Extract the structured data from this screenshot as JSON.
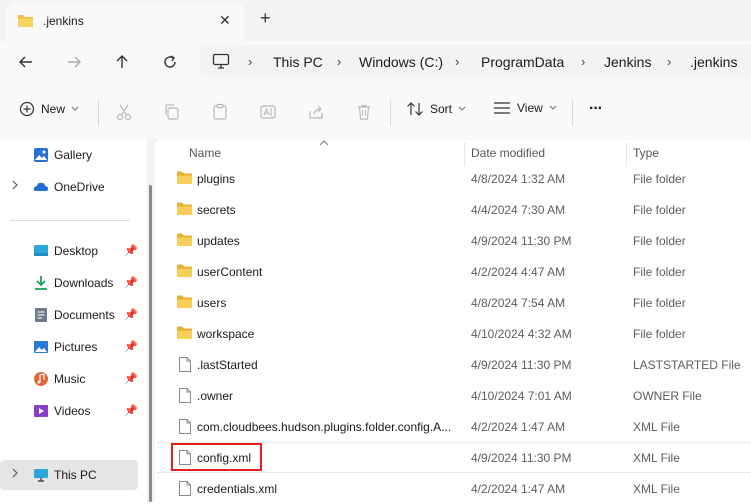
{
  "window": {
    "tab_title": ".jenkins",
    "close_glyph": "✕",
    "new_tab_glyph": "+"
  },
  "breadcrumb": {
    "items": [
      "This PC",
      "Windows (C:)",
      "ProgramData",
      "Jenkins",
      ".jenkins"
    ],
    "separator": "›"
  },
  "toolbar": {
    "new_label": "New",
    "sort_label": "Sort",
    "view_label": "View",
    "more_label": "···"
  },
  "sidebar": {
    "items": [
      {
        "label": "Gallery",
        "icon": "gallery-icon",
        "color": "#2a6fd6"
      },
      {
        "label": "OneDrive",
        "icon": "onedrive-icon",
        "color": "#1f6fd1"
      },
      {
        "label": "Desktop",
        "icon": "desktop-icon",
        "color": "#2aa7d6"
      },
      {
        "label": "Downloads",
        "icon": "downloads-icon",
        "color": "#1aa05a"
      },
      {
        "label": "Documents",
        "icon": "documents-icon",
        "color": "#6b7b8c"
      },
      {
        "label": "Pictures",
        "icon": "pictures-icon",
        "color": "#2a7ad6"
      },
      {
        "label": "Music",
        "icon": "music-icon",
        "color": "#e0663a"
      },
      {
        "label": "Videos",
        "icon": "videos-icon",
        "color": "#8a3fc8"
      },
      {
        "label": "This PC",
        "icon": "this-pc-icon",
        "color": "#2aa7d6"
      }
    ]
  },
  "columns": {
    "name": "Name",
    "date": "Date modified",
    "type": "Type"
  },
  "files": [
    {
      "name": "plugins",
      "date": "4/8/2024 1:32 AM",
      "type": "File folder",
      "kind": "folder"
    },
    {
      "name": "secrets",
      "date": "4/4/2024 7:30 AM",
      "type": "File folder",
      "kind": "folder"
    },
    {
      "name": "updates",
      "date": "4/9/2024 11:30 PM",
      "type": "File folder",
      "kind": "folder"
    },
    {
      "name": "userContent",
      "date": "4/2/2024 4:47 AM",
      "type": "File folder",
      "kind": "folder"
    },
    {
      "name": "users",
      "date": "4/8/2024 7:54 AM",
      "type": "File folder",
      "kind": "folder"
    },
    {
      "name": "workspace",
      "date": "4/10/2024 4:32 AM",
      "type": "File folder",
      "kind": "folder"
    },
    {
      "name": ".lastStarted",
      "date": "4/9/2024 11:30 PM",
      "type": "LASTSTARTED File",
      "kind": "file"
    },
    {
      "name": ".owner",
      "date": "4/10/2024 7:01 AM",
      "type": "OWNER File",
      "kind": "file"
    },
    {
      "name": "com.cloudbees.hudson.plugins.folder.config.A...",
      "date": "4/2/2024 1:47 AM",
      "type": "XML File",
      "kind": "file"
    },
    {
      "name": "config.xml",
      "date": "4/9/2024 11:30 PM",
      "type": "XML File",
      "kind": "file",
      "highlighted": true
    },
    {
      "name": "credentials.xml",
      "date": "4/2/2024 1:47 AM",
      "type": "XML File",
      "kind": "file"
    }
  ],
  "colors": {
    "folder": "#f4c04a",
    "highlight": "#e02020",
    "selected_nav": "#e5e5e5"
  }
}
